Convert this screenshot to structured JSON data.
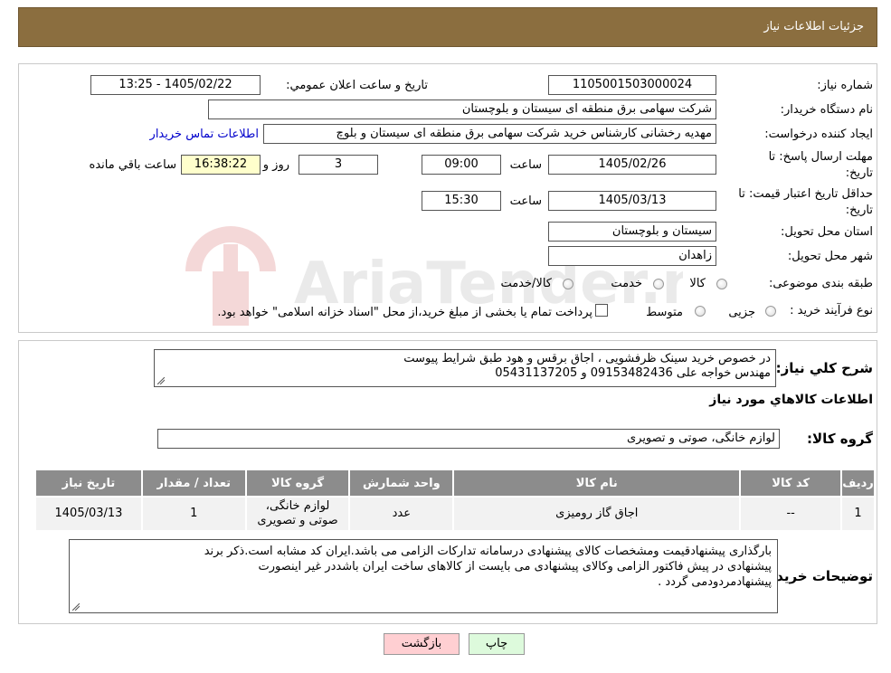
{
  "header": {
    "title": "جزئیات اطلاعات نیاز"
  },
  "form": {
    "need_number": {
      "label": "شماره نیاز:",
      "value": "1105001503000024"
    },
    "announce_datetime": {
      "label": "تاریخ و ساعت اعلان عمومي:",
      "value": "1405/02/22 - 13:25"
    },
    "buyer_org": {
      "label": "نام دستگاه خریدار:",
      "value": "شرکت سهامی برق منطقه ای سیستان و بلوچستان"
    },
    "requester": {
      "label": "ایجاد کننده درخواست:",
      "value": "مهدیه رخشانی کارشناس خرید شرکت سهامی برق منطقه ای سیستان و بلوچ",
      "contact_link": "اطلاعات تماس خریدار"
    },
    "deadline": {
      "label_line1": "مهلت ارسال پاسخ: تا",
      "label_line2": "تاریخ:",
      "date": "1405/02/26",
      "time_label": "ساعت",
      "time": "09:00",
      "days": "3",
      "days_label": "روز و",
      "remaining": "16:38:22",
      "remaining_label": "ساعت باقي مانده"
    },
    "price_validity": {
      "label_line1": "حداقل تاریخ اعتبار قیمت: تا",
      "label_line2": "تاریخ:",
      "date": "1405/03/13",
      "time_label": "ساعت",
      "time": "15:30"
    },
    "province": {
      "label": "استان محل تحویل:",
      "value": "سیستان و بلوچستان"
    },
    "city": {
      "label": "شهر محل تحویل:",
      "value": "زاهدان"
    },
    "category": {
      "label": "طبقه بندی موضوعی:",
      "options": [
        "کالا",
        "خدمت",
        "کالا/خدمت"
      ]
    },
    "purchase_type": {
      "label": "نوع فرآیند خرید :",
      "options": [
        "جزیی",
        "متوسط"
      ],
      "note": "پرداخت تمام یا بخشی از مبلغ خرید،از محل \"اسناد خزانه اسلامی\" خواهد بود."
    }
  },
  "description": {
    "label": "شرح کلي نیاز:",
    "line1": "در خصوص خرید سینک ظرفشویی ، اجاق برقس و هود طبق شرایط پیوست",
    "line2": "مهندس خواجه علی 09153482436 و 05431137205"
  },
  "goods_section": {
    "title": "اطلاعات کالاهاي مورد نیاز",
    "group_label": "گروه کالا:",
    "group_value": "لوازم خانگی، صوتی و تصویری"
  },
  "table": {
    "headers": [
      "ردیف",
      "کد کالا",
      "نام کالا",
      "واحد شمارش",
      "گروه کالا",
      "تعداد / مقدار",
      "تاریخ نیاز"
    ],
    "rows": [
      {
        "row": "1",
        "code": "--",
        "name": "اجاق گاز رومیزی",
        "unit": "عدد",
        "group_line1": "لوازم خانگی،",
        "group_line2": "صوتی و تصویری",
        "qty": "1",
        "date": "1405/03/13"
      }
    ]
  },
  "buyer_notes": {
    "label": "توضیحات خریدار:",
    "line1": "بارگذاری پیشنهادقیمت ومشخصات کالای پیشنهادی درسامانه تدارکات الزامی می باشد.ایران کد مشابه است.ذکر برند",
    "line2": "پیشنهادی در پیش فاکتور الزامی وکالای پیشنهادی می بایست از کالاهای ساخت ایران باشددر غیر اینصورت",
    "line3": "پیشنهادمردودمی گردد ."
  },
  "buttons": {
    "print": "چاپ",
    "back": "بازگشت"
  },
  "watermark": {
    "text": "AriaTender.neT"
  },
  "colors": {
    "header_bg": "#8b6e3f",
    "table_header_bg": "#8c8c8c",
    "link": "#0000cc"
  }
}
